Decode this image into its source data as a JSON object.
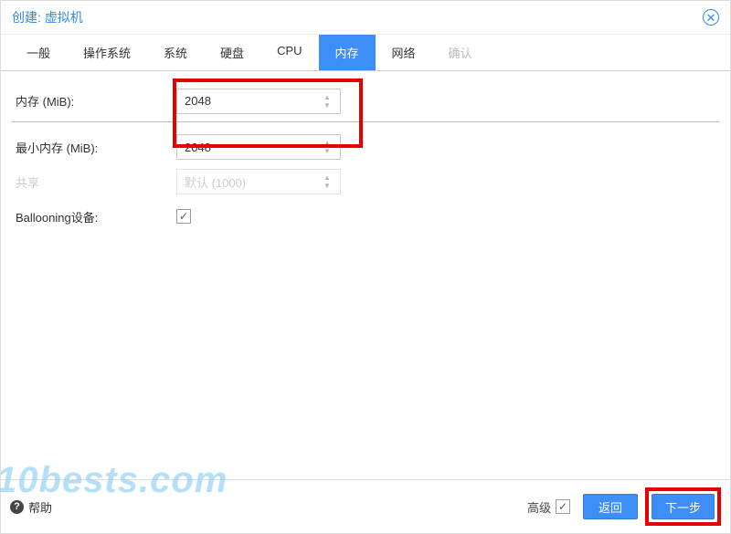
{
  "title": "创建: 虚拟机",
  "tabs": {
    "general": "一般",
    "os": "操作系统",
    "system": "系统",
    "disk": "硬盘",
    "cpu": "CPU",
    "memory": "内存",
    "network": "网络",
    "confirm": "确认"
  },
  "fields": {
    "memory_label": "内存 (MiB):",
    "memory_value": "2048",
    "min_memory_label": "最小内存 (MiB):",
    "min_memory_value": "2048",
    "shares_label": "共享",
    "shares_value": "默认 (1000)",
    "ballooning_label": "Ballooning设备:"
  },
  "footer": {
    "help": "帮助",
    "advanced": "高级",
    "back": "返回",
    "next": "下一步"
  },
  "watermark": "10bests.com"
}
